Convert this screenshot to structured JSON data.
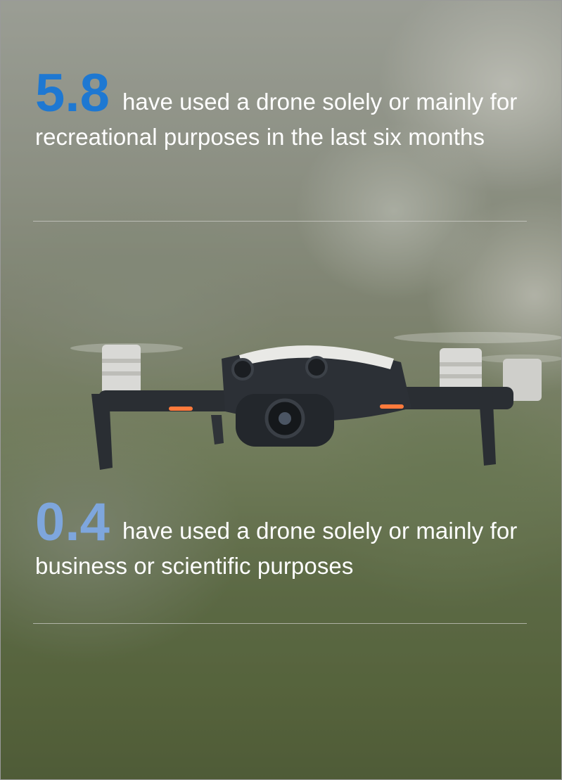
{
  "stats": [
    {
      "value": "5.8",
      "text": "have used a drone solely or mainly for recreational purposes in the last six months",
      "color": "#1e78d2"
    },
    {
      "value": "0.4",
      "text": "have used a drone solely or mainly for business or scientific purposes",
      "color": "#7ea6dd"
    }
  ],
  "background": {
    "photo_subject": "drone-photo"
  }
}
